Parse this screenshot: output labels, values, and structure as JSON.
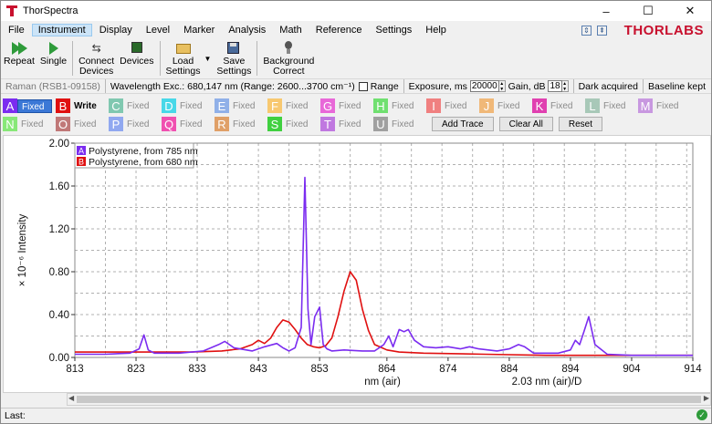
{
  "window": {
    "title": "ThorSpectra",
    "brand": "THORLABS",
    "controls": [
      "–",
      "☐",
      "✕"
    ]
  },
  "menu": [
    "File",
    "Instrument",
    "Display",
    "Level",
    "Marker",
    "Analysis",
    "Math",
    "Reference",
    "Settings",
    "Help"
  ],
  "menu_active": "Instrument",
  "toolbar": {
    "repeat": "Repeat",
    "single": "Single",
    "connect_devices": "Connect\nDevices",
    "devices": "Devices",
    "load_settings": "Load\nSettings",
    "save_settings": "Save\nSettings",
    "background_correct": "Background\nCorrect"
  },
  "status": {
    "device": "Raman (RSB1-09158)",
    "wavelength": "Wavelength Exc.: 680,147 nm",
    "range": "(Range: 2600...3700 cm⁻¹)",
    "range_label": "Range",
    "exposure_label": "Exposure, ms",
    "exposure_value": "20000",
    "gain_label": "Gain, dB",
    "gain_value": "18",
    "dark": "Dark acquired",
    "baseline": "Baseline kept"
  },
  "traces_row1": [
    {
      "letter": "A",
      "mode": "Fixed",
      "color": "#7b2cf0"
    },
    {
      "letter": "B",
      "mode": "Write",
      "color": "#e01010"
    },
    {
      "letter": "C",
      "mode": "Fixed",
      "color": "#80c8b0"
    },
    {
      "letter": "D",
      "mode": "Fixed",
      "color": "#48d8e8"
    },
    {
      "letter": "E",
      "mode": "Fixed",
      "color": "#90b0e8"
    },
    {
      "letter": "F",
      "mode": "Fixed",
      "color": "#f8c870"
    },
    {
      "letter": "G",
      "mode": "Fixed",
      "color": "#e868d8"
    },
    {
      "letter": "H",
      "mode": "Fixed",
      "color": "#70e070"
    },
    {
      "letter": "I",
      "mode": "Fixed",
      "color": "#f08080"
    },
    {
      "letter": "J",
      "mode": "Fixed",
      "color": "#f0b878"
    },
    {
      "letter": "K",
      "mode": "Fixed",
      "color": "#e040b0"
    },
    {
      "letter": "L",
      "mode": "Fixed",
      "color": "#a8c8b8"
    },
    {
      "letter": "M",
      "mode": "Fixed",
      "color": "#c898e0"
    }
  ],
  "traces_row2": [
    {
      "letter": "N",
      "mode": "Fixed",
      "color": "#88e878"
    },
    {
      "letter": "O",
      "mode": "Fixed",
      "color": "#c07878"
    },
    {
      "letter": "P",
      "mode": "Fixed",
      "color": "#90a8f0"
    },
    {
      "letter": "Q",
      "mode": "Fixed",
      "color": "#f050b0"
    },
    {
      "letter": "R",
      "mode": "Fixed",
      "color": "#e0a068"
    },
    {
      "letter": "S",
      "mode": "Fixed",
      "color": "#40d040"
    },
    {
      "letter": "T",
      "mode": "Fixed",
      "color": "#c078e0"
    },
    {
      "letter": "U",
      "mode": "Fixed",
      "color": "#a0a0a0"
    }
  ],
  "actions": {
    "add_trace": "Add Trace",
    "clear_all": "Clear All",
    "reset": "Reset"
  },
  "statusbar": {
    "last": "Last:"
  },
  "chart_data": {
    "type": "line",
    "ylabel": "× 10⁻⁶ Intensity",
    "xlabel": "nm (air)",
    "xlabel2": "2.03 nm (air)/D",
    "xlim": [
      813,
      914
    ],
    "ylim": [
      0,
      2.0
    ],
    "xticks": [
      813,
      823,
      833,
      843,
      853,
      864,
      874,
      884,
      894,
      904,
      914
    ],
    "yticks": [
      0.0,
      0.4,
      0.8,
      1.2,
      1.6,
      2.0
    ],
    "ytick_labels": [
      "0.00",
      "0.40",
      "0.80",
      "1.20",
      "1.60",
      "2.00"
    ],
    "grid": true,
    "legend_position": "top-left",
    "series": [
      {
        "name": "Polystyrene, from 785 nm",
        "legend_letter": "A",
        "color": "#7b2cf0",
        "x": [
          813,
          818,
          822,
          823.5,
          824.3,
          825,
          826,
          830,
          834,
          836.5,
          837.5,
          839,
          842,
          844,
          846,
          847,
          848,
          849,
          850,
          850.6,
          851.1,
          851.6,
          852.2,
          853,
          853.6,
          854.2,
          855,
          857,
          860,
          862,
          863.5,
          864.3,
          865,
          866,
          866.8,
          867.5,
          868.5,
          870,
          872,
          874,
          876,
          877.5,
          879,
          882,
          884,
          885.5,
          886.5,
          888,
          892,
          894,
          894.8,
          895.5,
          896.2,
          897,
          898,
          900,
          904,
          908,
          914
        ],
        "y": [
          0.03,
          0.03,
          0.04,
          0.08,
          0.21,
          0.07,
          0.04,
          0.04,
          0.06,
          0.12,
          0.15,
          0.09,
          0.06,
          0.1,
          0.13,
          0.09,
          0.06,
          0.09,
          0.28,
          1.68,
          0.45,
          0.12,
          0.38,
          0.47,
          0.12,
          0.08,
          0.06,
          0.07,
          0.06,
          0.06,
          0.12,
          0.2,
          0.1,
          0.26,
          0.24,
          0.26,
          0.16,
          0.1,
          0.09,
          0.1,
          0.08,
          0.1,
          0.08,
          0.06,
          0.08,
          0.12,
          0.1,
          0.04,
          0.04,
          0.07,
          0.16,
          0.12,
          0.24,
          0.38,
          0.12,
          0.03,
          0.02,
          0.02,
          0.02
        ]
      },
      {
        "name": "Polystyrene, from 680 nm",
        "legend_letter": "B",
        "color": "#e01010",
        "x": [
          813,
          818,
          825,
          832,
          837,
          840,
          842,
          843,
          844,
          845,
          846,
          847,
          848,
          849,
          850,
          851,
          852,
          853,
          854,
          855,
          856,
          857,
          858,
          859,
          860,
          861,
          862,
          864,
          866,
          870,
          880,
          890,
          900,
          914
        ],
        "y": [
          0.05,
          0.05,
          0.05,
          0.05,
          0.06,
          0.08,
          0.12,
          0.16,
          0.13,
          0.18,
          0.28,
          0.35,
          0.33,
          0.26,
          0.18,
          0.12,
          0.1,
          0.09,
          0.11,
          0.18,
          0.38,
          0.62,
          0.8,
          0.72,
          0.45,
          0.25,
          0.12,
          0.07,
          0.05,
          0.04,
          0.03,
          0.02,
          0.02,
          0.02
        ]
      }
    ]
  }
}
